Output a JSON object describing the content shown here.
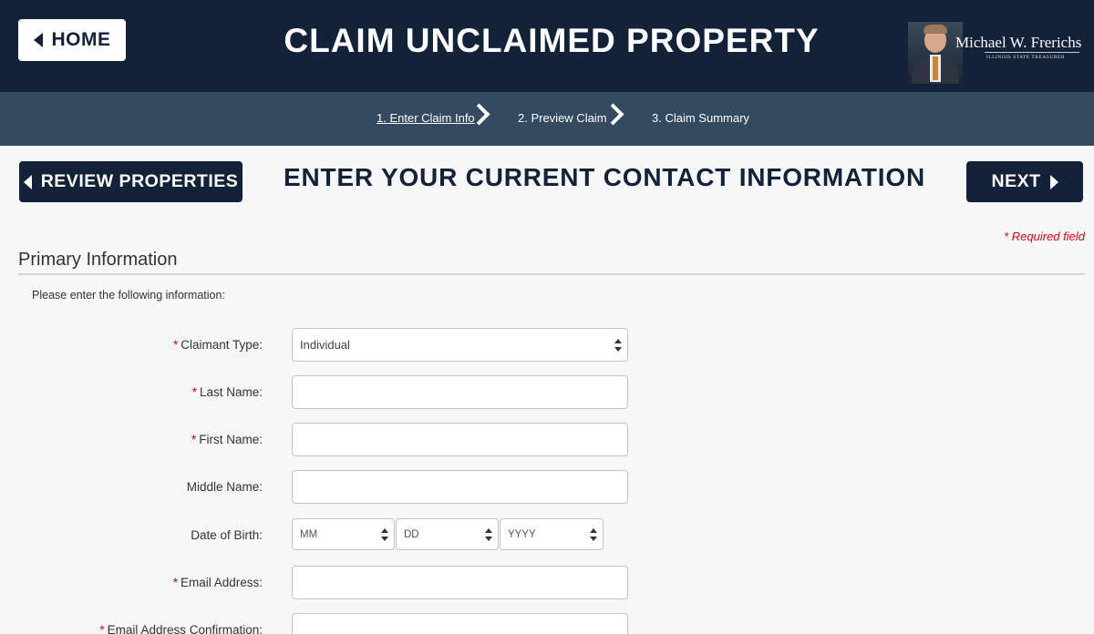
{
  "header": {
    "home_label": "HOME",
    "title": "CLAIM UNCLAIMED PROPERTY",
    "logo_name": "Michael W. Frerichs",
    "logo_subtitle": "ILLINOIS STATE TREASURER"
  },
  "steps": [
    {
      "label": "1. Enter Claim Info",
      "active": true
    },
    {
      "label": "2. Preview Claim",
      "active": false
    },
    {
      "label": "3. Claim Summary",
      "active": false
    }
  ],
  "nav": {
    "back_label": "REVIEW PROPERTIES",
    "next_label": "NEXT"
  },
  "page_heading": "ENTER YOUR CURRENT CONTACT INFORMATION",
  "required_note": "* Required field",
  "section": {
    "title": "Primary Information",
    "instructions": "Please enter the following information:"
  },
  "form": {
    "claimant_type": {
      "label": "Claimant Type:",
      "required": true,
      "value": "Individual"
    },
    "last_name": {
      "label": "Last Name:",
      "required": true,
      "value": ""
    },
    "first_name": {
      "label": "First Name:",
      "required": true,
      "value": ""
    },
    "middle_name": {
      "label": "Middle Name:",
      "required": false,
      "value": ""
    },
    "dob": {
      "label": "Date of Birth:",
      "required": false,
      "month": "MM",
      "day": "DD",
      "year": "YYYY"
    },
    "email": {
      "label": "Email Address:",
      "required": true,
      "value": ""
    },
    "email_confirm": {
      "label": "Email Address Confirmation:",
      "required": true,
      "value": ""
    }
  },
  "colors": {
    "navy": "#132238",
    "step_bar": "#344a60",
    "required_red": "#d0021b"
  }
}
